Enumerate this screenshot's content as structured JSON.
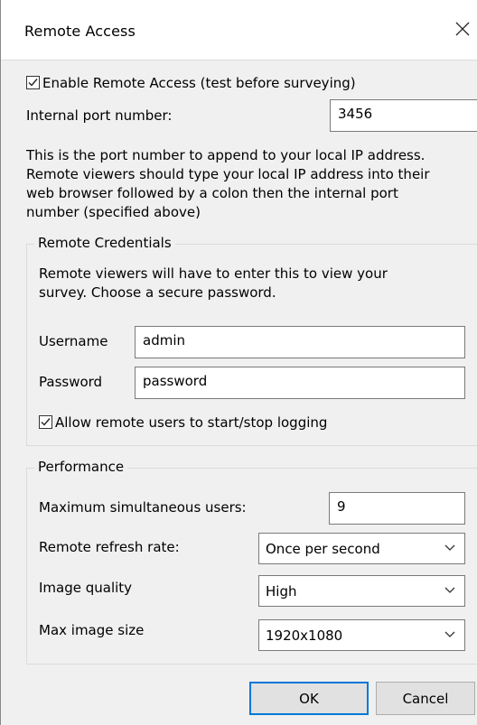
{
  "window": {
    "title": "Remote Access"
  },
  "enable_remote": {
    "label": "Enable Remote Access (test before surveying)",
    "checked": true
  },
  "internal_port": {
    "label": "Internal port number:",
    "value": "3456"
  },
  "port_description": [
    "This is the port number to append to your local IP address.",
    "Remote viewers should type your local IP address into their",
    "web browser followed by a colon then the internal port",
    "number (specified above)"
  ],
  "credentials": {
    "group_label": "Remote Credentials",
    "description": [
      "Remote viewers will have to enter this to view your",
      "survey. Choose a secure password."
    ],
    "username_label": "Username",
    "username_value": "admin",
    "password_label": "Password",
    "password_value": "password",
    "allow_logging_label": "Allow remote users to start/stop logging",
    "allow_logging_checked": true
  },
  "performance": {
    "group_label": "Performance",
    "max_users_label": "Maximum simultaneous users:",
    "max_users_value": "9",
    "refresh_label": "Remote refresh rate:",
    "refresh_value": "Once per second",
    "quality_label": "Image quality",
    "quality_value": "High",
    "max_size_label": "Max image size",
    "max_size_value": "1920x1080"
  },
  "buttons": {
    "ok": "OK",
    "cancel": "Cancel"
  }
}
